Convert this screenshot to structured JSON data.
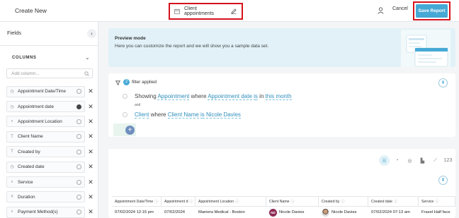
{
  "header": {
    "title": "Create New",
    "report_name": "Client appointments",
    "cancel_label": "Cancel",
    "save_label": "Save Report"
  },
  "sidebar": {
    "title": "Fields",
    "columns_label": "COLUMNS",
    "add_column_placeholder": "Add column...",
    "fields": [
      {
        "label": "Appointment Date/Time",
        "icon": "clock-icon",
        "settings_dark": false
      },
      {
        "label": "Appointment date",
        "icon": "clock-icon",
        "settings_dark": true
      },
      {
        "label": "Appointment Location",
        "icon": "search-icon",
        "settings_dark": false
      },
      {
        "label": "Client Name",
        "icon": "text-icon",
        "settings_dark": false
      },
      {
        "label": "Created by",
        "icon": "text-icon",
        "settings_dark": false
      },
      {
        "label": "Created date",
        "icon": "clock-icon",
        "settings_dark": false
      },
      {
        "label": "Service",
        "icon": "search-icon",
        "settings_dark": false
      },
      {
        "label": "Duration",
        "icon": "hash-icon",
        "settings_dark": false
      },
      {
        "label": "Payment Method(s)",
        "icon": "search-icon",
        "settings_dark": false
      }
    ]
  },
  "preview": {
    "title": "Preview mode",
    "description": "Here you can customize the report and we will show you a sample data set."
  },
  "filter": {
    "count": "2",
    "label": "filter applied",
    "cond1": {
      "showing": "Showing",
      "entity": "Appointment",
      "where": "where",
      "field": "Appointment date",
      "op": "is",
      "in": "in",
      "value": "this month"
    },
    "and_label": "and",
    "cond2": {
      "entity": "Client",
      "where": "where",
      "field": "Client Name",
      "op": "is",
      "value": "Nicole Davies"
    }
  },
  "table": {
    "number_label": "123",
    "headers": [
      "Appointment Date/Time",
      "Appointment d",
      "Appointment Location",
      "Client Name",
      "Created by",
      "Created date",
      "Service"
    ],
    "row": {
      "datetime": "07/02/2024 12:15 pm",
      "date": "07/02/2024",
      "location": "Maniera Medical - Boston",
      "client_initials": "ND",
      "client": "Nicole Davies",
      "created_by": "Nicole Davies",
      "created_date": "07/02/2024 07:13 am",
      "service": "Fraxel Half face"
    }
  },
  "colors": {
    "accent": "#46a9d5",
    "highlight_box": "#d5121c",
    "preview_bg": "#e1f1f7",
    "avatar": "#8c2a54"
  }
}
